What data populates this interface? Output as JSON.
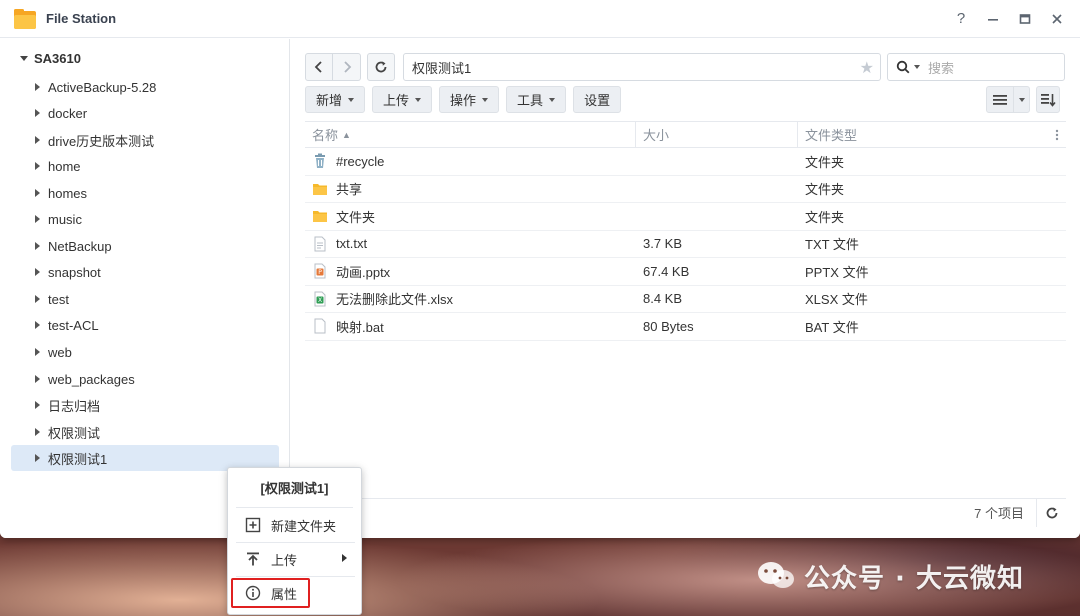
{
  "window": {
    "title": "File Station",
    "help": "?",
    "minimize": "−",
    "maximize": "□",
    "close": "✕"
  },
  "sidebar": {
    "root": "SA3610",
    "items": [
      {
        "label": "ActiveBackup-5.28"
      },
      {
        "label": "docker"
      },
      {
        "label": "drive历史版本测试"
      },
      {
        "label": "home"
      },
      {
        "label": "homes"
      },
      {
        "label": "music"
      },
      {
        "label": "NetBackup"
      },
      {
        "label": "snapshot"
      },
      {
        "label": "test"
      },
      {
        "label": "test-ACL"
      },
      {
        "label": "web"
      },
      {
        "label": "web_packages"
      },
      {
        "label": "日志归档"
      },
      {
        "label": "权限测试"
      },
      {
        "label": "权限测试1",
        "selected": true
      }
    ]
  },
  "toolbar": {
    "path": "权限测试1",
    "search_placeholder": "搜索",
    "buttons": {
      "create": "新增",
      "upload": "上传",
      "action": "操作",
      "tools": "工具",
      "settings": "设置"
    }
  },
  "table": {
    "columns": {
      "name": "名称",
      "size": "大小",
      "type": "文件类型"
    },
    "rows": [
      {
        "name": "#recycle",
        "size": "",
        "type": "文件夹",
        "icon": "recycle-bin-icon"
      },
      {
        "name": "共享",
        "size": "",
        "type": "文件夹",
        "icon": "folder-icon"
      },
      {
        "name": "文件夹",
        "size": "",
        "type": "文件夹",
        "icon": "folder-icon"
      },
      {
        "name": "txt.txt",
        "size": "3.7 KB",
        "type": "TXT 文件",
        "icon": "txt-file-icon"
      },
      {
        "name": "动画.pptx",
        "size": "67.4 KB",
        "type": "PPTX 文件",
        "icon": "pptx-file-icon"
      },
      {
        "name": "无法删除此文件.xlsx",
        "size": "8.4 KB",
        "type": "XLSX 文件",
        "icon": "xlsx-file-icon"
      },
      {
        "name": "映射.bat",
        "size": "80 Bytes",
        "type": "BAT 文件",
        "icon": "bat-file-icon"
      }
    ]
  },
  "status": {
    "count": "7 个项目"
  },
  "context_menu": {
    "title": "[权限测试1]",
    "new_folder": "新建文件夹",
    "upload": "上传",
    "properties": "属性"
  },
  "watermark": {
    "text": "公众号 · 大云微知"
  },
  "colors": {
    "selection": "#dde9f7",
    "folder": "#f6b92b",
    "highlight": "#e02020"
  }
}
